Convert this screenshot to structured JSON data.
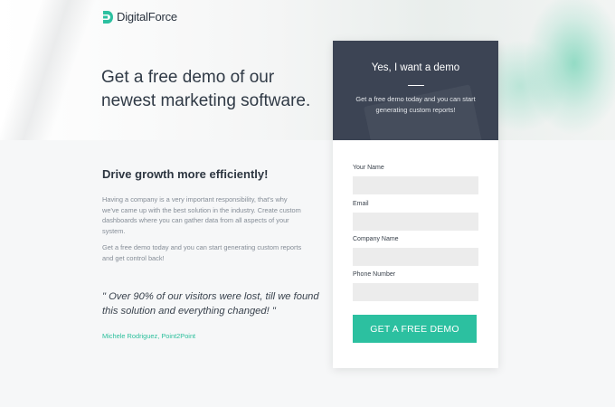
{
  "brand": {
    "name": "DigitalForce",
    "accent": "#2cc0a0",
    "dark": "#3c4454"
  },
  "hero": {
    "title": "Get a free demo of our newest marketing software."
  },
  "content": {
    "heading": "Drive growth more efficiently!",
    "paragraph1": "Having a company is a very important responsibility, that's why we've came up with the best solution in the industry. Create custom dashboards where you can gather data from all aspects of your system.",
    "paragraph2": "Get a free demo today and you can start generating custom reports and get control back!",
    "quote": "\" Over 90% of our visitors were lost, till we found this solution and everything changed! \"",
    "quote_author": "Michele Rodriguez, Point2Point"
  },
  "form": {
    "title": "Yes, I want a demo",
    "subtitle": "Get a free demo today and you can start generating custom reports!",
    "fields": [
      {
        "label": "Your Name",
        "value": ""
      },
      {
        "label": "Email",
        "value": ""
      },
      {
        "label": "Company Name",
        "value": ""
      },
      {
        "label": "Phone Number",
        "value": ""
      }
    ],
    "submit_label": "GET A FREE DEMO"
  }
}
